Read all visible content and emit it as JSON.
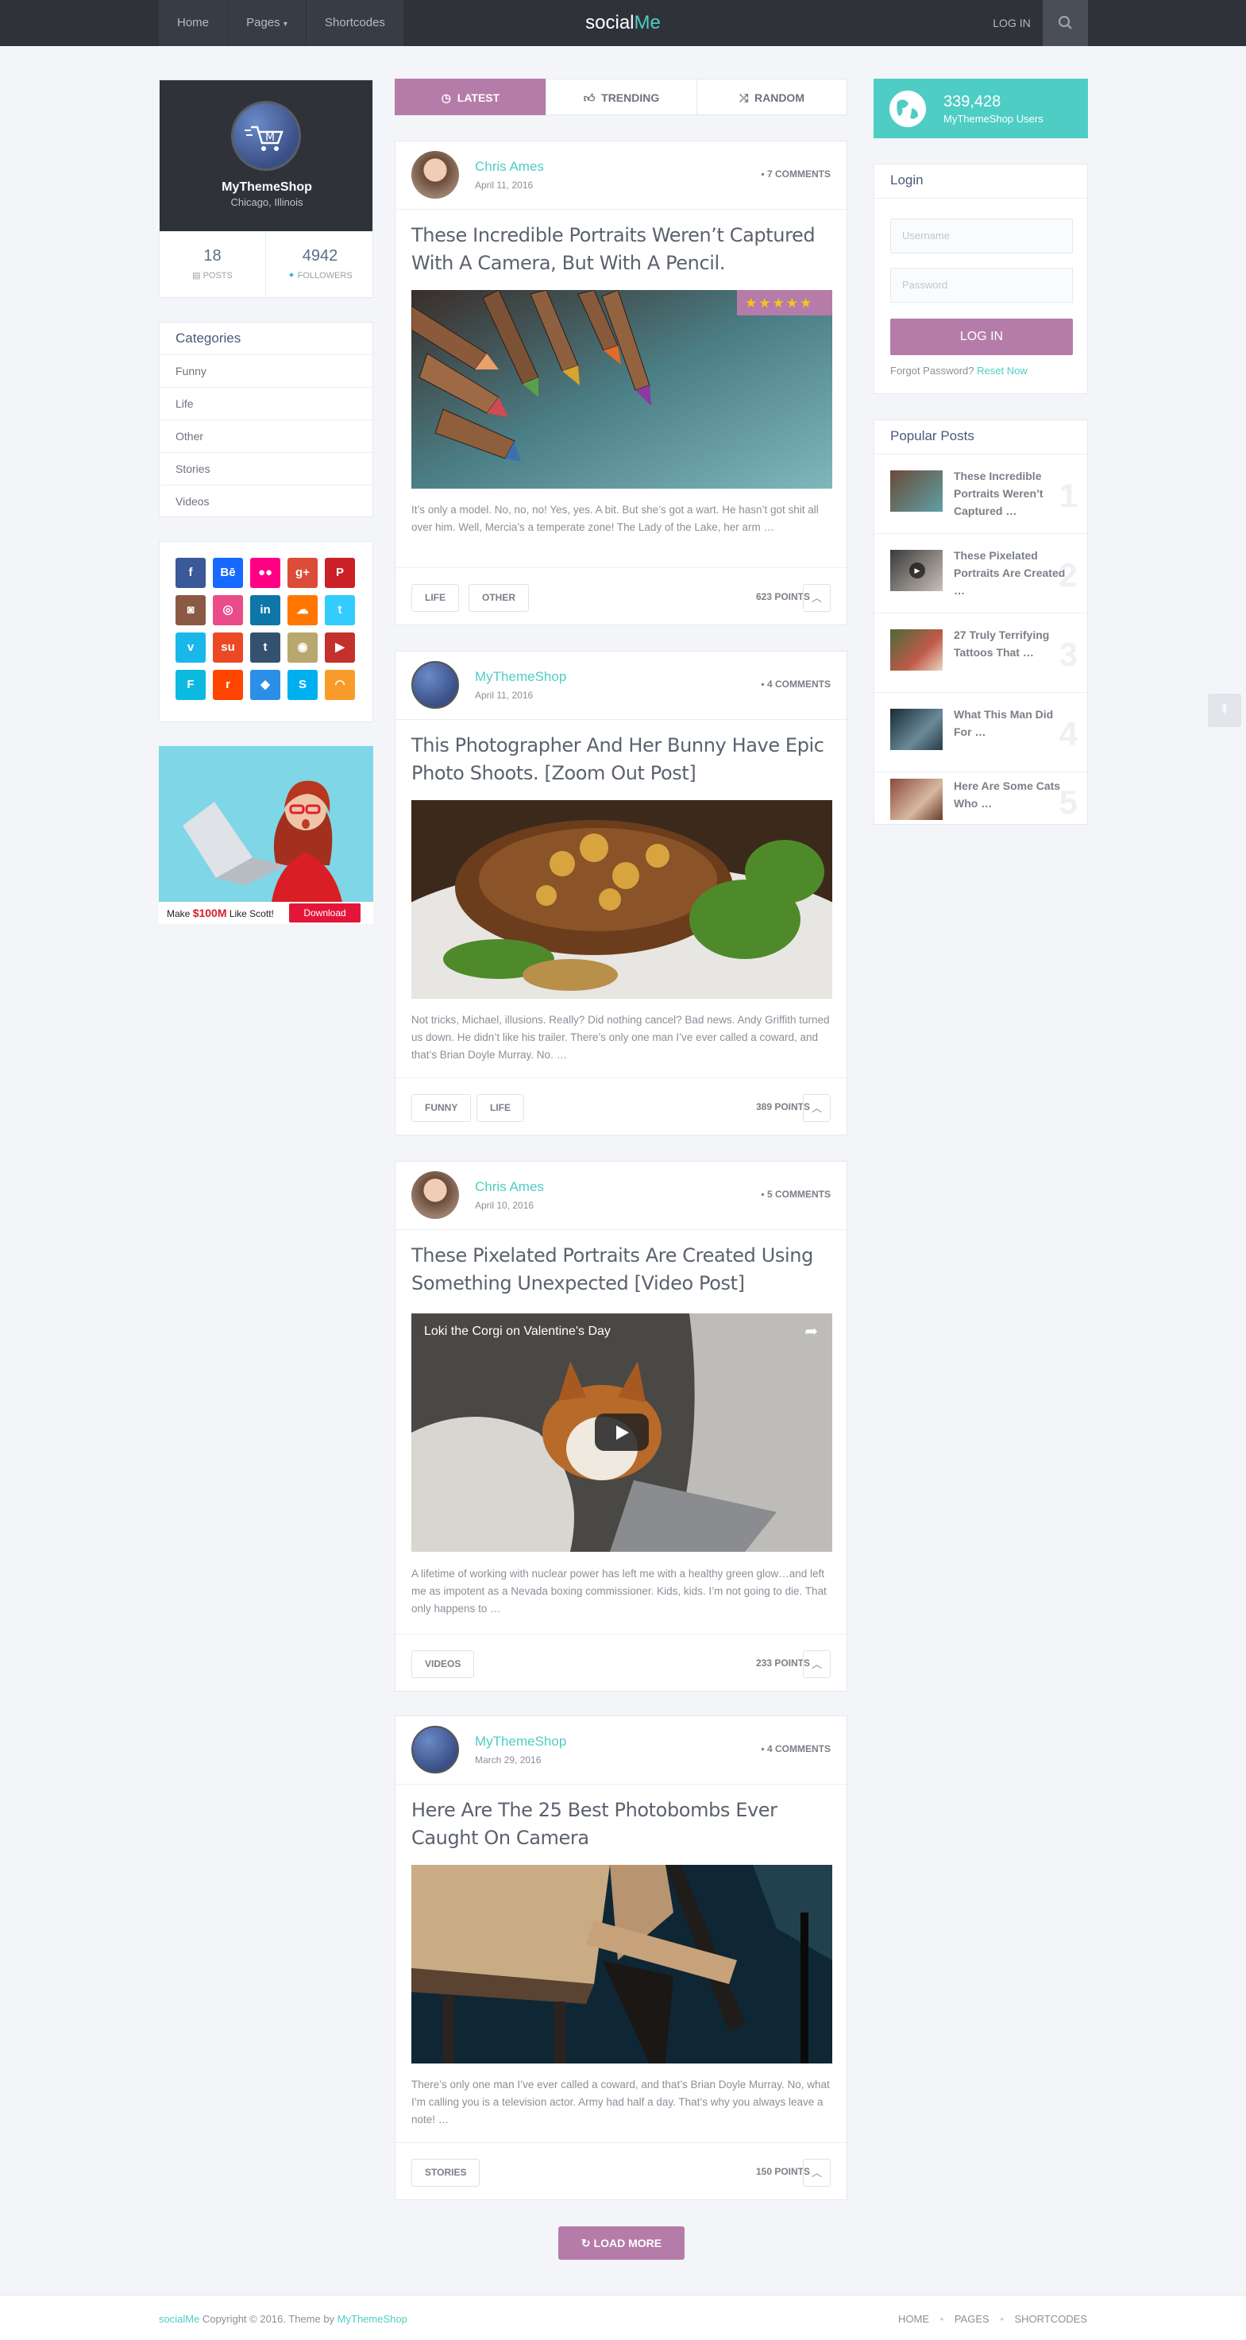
{
  "nav": {
    "home": "Home",
    "pages": "Pages",
    "shortcodes": "Shortcodes",
    "login": "LOG IN",
    "logo_main": "social",
    "logo_accent": "Me"
  },
  "profile": {
    "name": "MyThemeShop",
    "location": "Chicago, Illinois",
    "posts_count": "18",
    "posts_label": "POSTS",
    "followers_count": "4942",
    "followers_label": "FOLLOWERS"
  },
  "categories": {
    "title": "Categories",
    "items": [
      "Funny",
      "Life",
      "Other",
      "Stories",
      "Videos"
    ]
  },
  "social_icons": [
    {
      "name": "facebook-icon",
      "glyph": "f",
      "color": "#3b5998"
    },
    {
      "name": "behance-icon",
      "glyph": "Bē",
      "color": "#1769ff"
    },
    {
      "name": "flickr-icon",
      "glyph": "●●",
      "color": "#ff0084"
    },
    {
      "name": "google-plus-icon",
      "glyph": "g+",
      "color": "#dd4b39"
    },
    {
      "name": "pinterest-icon",
      "glyph": "P",
      "color": "#cb2027"
    },
    {
      "name": "instagram-icon",
      "glyph": "◙",
      "color": "#8a5a44"
    },
    {
      "name": "dribbble-icon",
      "glyph": "◎",
      "color": "#ea4c89"
    },
    {
      "name": "linkedin-icon",
      "glyph": "in",
      "color": "#0e76a8"
    },
    {
      "name": "soundcloud-icon",
      "glyph": "☁",
      "color": "#ff7700"
    },
    {
      "name": "twitter-icon",
      "glyph": "t",
      "color": "#33ccff"
    },
    {
      "name": "vimeo-icon",
      "glyph": "v",
      "color": "#1ab7ea"
    },
    {
      "name": "stumbleupon-icon",
      "glyph": "su",
      "color": "#eb4924"
    },
    {
      "name": "tumblr-icon",
      "glyph": "t",
      "color": "#34526f"
    },
    {
      "name": "github-icon",
      "glyph": "◉",
      "color": "#b8a76f"
    },
    {
      "name": "youtube-icon",
      "glyph": "▶",
      "color": "#c4302b"
    },
    {
      "name": "foursquare-icon",
      "glyph": "F",
      "color": "#0cbadf"
    },
    {
      "name": "reddit-icon",
      "glyph": "r",
      "color": "#ff4500"
    },
    {
      "name": "dropbox-icon",
      "glyph": "◆",
      "color": "#2c8fe7"
    },
    {
      "name": "skype-icon",
      "glyph": "S",
      "color": "#00aff0"
    },
    {
      "name": "rss-icon",
      "glyph": "◠",
      "color": "#f99b2a"
    }
  ],
  "ad": {
    "make": "Make ",
    "amount": "$100M",
    "like": " Like Scott!",
    "button": "Download"
  },
  "tabs": {
    "latest": "LATEST",
    "trending": "TRENDING",
    "random": "RANDOM"
  },
  "posts": [
    {
      "author": "Chris Ames",
      "date": "April 11, 2016",
      "comments": "7 COMMENTS",
      "title": "These Incredible Portraits Weren’t Captured With A Camera, But With A Pencil.",
      "excerpt": "It’s only a model. No, no, no! Yes, yes. A bit. But she’s got a wart. He hasn’t got shit all over him. Well, Mercia’s a temperate zone! The Lady of the Lake, her arm …",
      "tags": [
        "LIFE",
        "OTHER"
      ],
      "points": "623 POINTS",
      "rating_stars": 5
    },
    {
      "author": "MyThemeShop",
      "date": "April 11, 2016",
      "comments": "4 COMMENTS",
      "title": "This Photographer And Her Bunny Have Epic Photo Shoots. [Zoom Out Post]",
      "excerpt": "Not tricks, Michael, illusions. Really? Did nothing cancel? Bad news. Andy Griffith turned us down. He didn’t like his trailer. There’s only one man I’ve ever called a coward, and that’s Brian Doyle Murray. No. …",
      "tags": [
        "FUNNY",
        "LIFE"
      ],
      "points": "389 POINTS"
    },
    {
      "author": "Chris Ames",
      "date": "April 10, 2016",
      "comments": "5 COMMENTS",
      "title": "These Pixelated Portraits Are Created Using Something Unexpected [Video Post]",
      "video_title": "Loki the Corgi on Valentine's Day",
      "excerpt": "A lifetime of working with nuclear power has left me with a healthy green glow…and left me as impotent as a Nevada boxing commissioner. Kids, kids. I’m not going to die. That only happens to …",
      "tags": [
        "VIDEOS"
      ],
      "points": "233 POINTS"
    },
    {
      "author": "MyThemeShop",
      "date": "March 29, 2016",
      "comments": "4 COMMENTS",
      "title": "Here Are The 25 Best Photobombs Ever Caught On Camera",
      "excerpt": "There’s only one man I’ve ever called a coward, and that’s Brian Doyle Murray. No, what I’m calling you is a television actor. Army had half a day. That’s why you always leave a note! …",
      "tags": [
        "STORIES"
      ],
      "points": "150 POINTS"
    }
  ],
  "load_more": "LOAD MORE",
  "users_widget": {
    "count": "339,428",
    "label": "MyThemeShop Users"
  },
  "login": {
    "title": "Login",
    "username_placeholder": "Username",
    "password_placeholder": "Password",
    "button": "LOG IN",
    "forgot": "Forgot Password?",
    "reset": "Reset Now"
  },
  "popular": {
    "title": "Popular Posts",
    "items": [
      {
        "title": "These Incredible Portraits Weren’t Captured …",
        "num": "1"
      },
      {
        "title": "These Pixelated Portraits Are Created …",
        "num": "2"
      },
      {
        "title": "27 Truly Terrifying Tattoos That …",
        "num": "3"
      },
      {
        "title": "What This Man Did For …",
        "num": "4"
      },
      {
        "title": "Here Are Some Cats Who …",
        "num": "5"
      }
    ]
  },
  "footer": {
    "brand": "socialMe",
    "copyright": " Copyright © 2016. Theme by ",
    "theme_by": "MyThemeShop",
    "links": [
      "HOME",
      "PAGES",
      "SHORTCODES"
    ]
  },
  "colors": {
    "accent": "#b57ca9",
    "teal": "#4ecdc4",
    "dark": "#2f3239",
    "star": "#f5c518"
  }
}
